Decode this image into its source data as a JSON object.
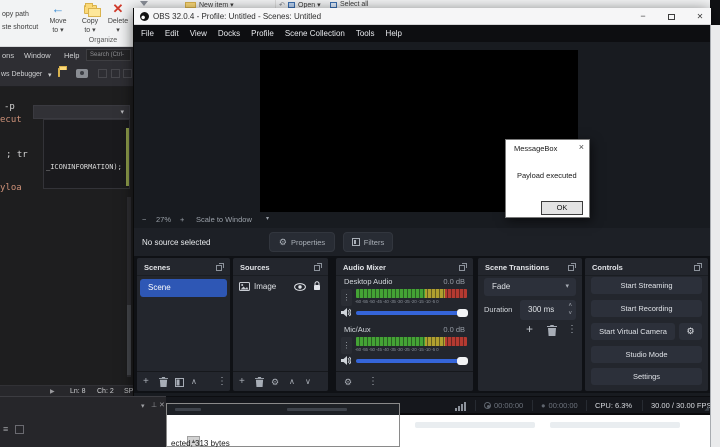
{
  "icons": {
    "caret_down": "▾",
    "chevron_up": "∧",
    "chevron_down": "∨",
    "dots_vertical": "⋮",
    "plus": "+",
    "minus": "−",
    "gear": "⚙",
    "close_x": "✕",
    "dialog_close": "×",
    "play": "▶",
    "arrow_left": "←",
    "undo": "↶",
    "scroll_up": "▲",
    "menu_grip": "≡",
    "spin_up": "˄",
    "spin_down": "˅",
    "resize_grip": "◢"
  },
  "explorer": {
    "clipped_left": {
      "line1": "opy path",
      "line2": "ste shortcut"
    },
    "ribbon_buttons": {
      "move_line1": "Move",
      "move_line2": "to ▾",
      "copy_line1": "Copy",
      "copy_line2": "to ▾",
      "delete_line1": "Delete",
      "delete_line2": "▾"
    },
    "group_label": "Organize",
    "top_items": {
      "new_item": "New item ▾",
      "open": "Open ▾",
      "select_all": "Select all"
    }
  },
  "ide": {
    "menu": {
      "item1": "ons",
      "item2": "Window",
      "item3": "Help"
    },
    "search_box": "Search (Ctrl-",
    "debugger_label": "ws Debugger",
    "code": {
      "frag1": "-p",
      "frag2": "ecut",
      "frag3": "; tr",
      "frag4": "_ICONINFORMATION);",
      "frag5": "yloa"
    },
    "status": {
      "line": "Ln: 8",
      "column": "Ch: 2",
      "clipped": "SP"
    },
    "console_text": "ected, 313 bytes"
  },
  "obs": {
    "window_title": "OBS 32.0.4 - Profile: Untitled - Scenes: Untitled",
    "menu": [
      "File",
      "Edit",
      "View",
      "Docks",
      "Profile",
      "Scene Collection",
      "Tools",
      "Help"
    ],
    "preview_controls": {
      "zoom_out": "−",
      "zoom_value": "27%",
      "zoom_in": "+",
      "scale_mode": "Scale to Window"
    },
    "source_bar": {
      "message": "No source selected",
      "properties": "Properties",
      "filters": "Filters"
    },
    "scenes": {
      "title": "Scenes",
      "selected_scene": "Scene"
    },
    "sources": {
      "title": "Sources",
      "item": "Image"
    },
    "mixer": {
      "title": "Audio Mixer",
      "ch1_name": "Desktop Audio",
      "ch1_level": "0.0 dB",
      "ch2_name": "Mic/Aux",
      "ch2_level": "0.0 dB",
      "scale_ticks": "-60 -55 -50 -45 -40 -35 -30 -25 -20 -15 -10 -5 0"
    },
    "transitions": {
      "title": "Scene Transitions",
      "current": "Fade",
      "duration_label": "Duration",
      "duration_value": "300 ms"
    },
    "controls": {
      "title": "Controls",
      "buttons": [
        "Start Streaming",
        "Start Recording",
        "Start Virtual Camera",
        "Studio Mode",
        "Settings"
      ]
    },
    "status_bar": {
      "stream_time": "00:00:00",
      "record_time": "00:00:00",
      "cpu": "CPU: 6.3%",
      "fps": "30.00 / 30.00 FPS"
    }
  },
  "dialog": {
    "title": "MessageBox",
    "message": "Payload executed",
    "ok_label": "OK"
  }
}
